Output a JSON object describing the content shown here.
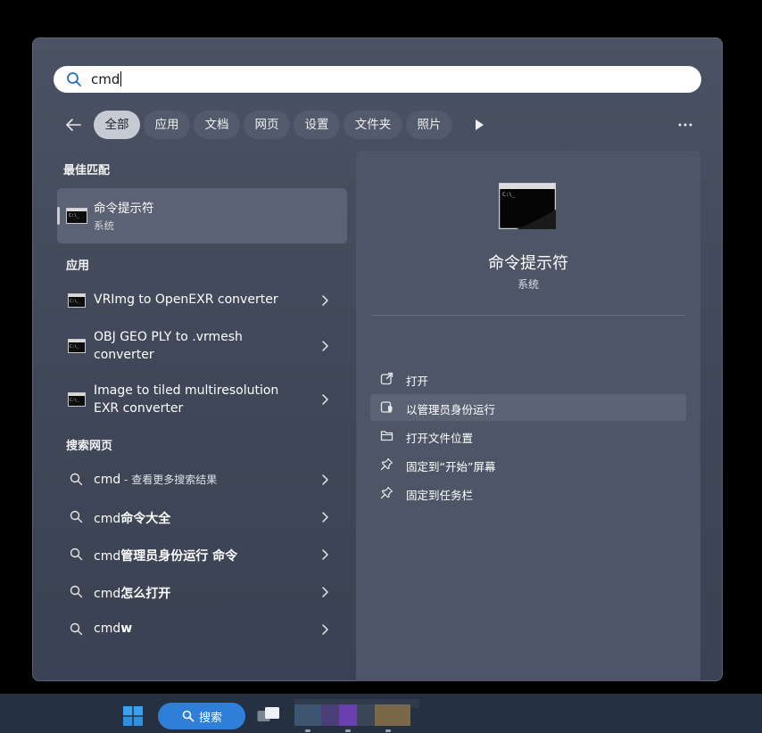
{
  "search": {
    "query": "cmd"
  },
  "filters": [
    {
      "label": "全部",
      "active": true
    },
    {
      "label": "应用"
    },
    {
      "label": "文档"
    },
    {
      "label": "网页"
    },
    {
      "label": "设置"
    },
    {
      "label": "文件夹"
    },
    {
      "label": "照片"
    }
  ],
  "best_match": {
    "heading": "最佳匹配",
    "title": "命令提示符",
    "subtitle": "系统"
  },
  "apps": {
    "heading": "应用",
    "items": [
      {
        "line1": "VRImg to OpenEXR converter",
        "line2": ""
      },
      {
        "line1": "OBJ GEO PLY to .vrmesh",
        "line2": "converter"
      },
      {
        "line1": "Image to tiled multiresolution",
        "line2": "EXR converter"
      }
    ]
  },
  "web": {
    "heading": "搜索网页",
    "items": [
      {
        "prefix": "cmd",
        "bold": "",
        "hint": " - 查看更多搜索结果"
      },
      {
        "prefix": "cmd",
        "bold": "命令大全",
        "hint": ""
      },
      {
        "prefix": "cmd",
        "bold": "管理员身份运行 命令",
        "hint": ""
      },
      {
        "prefix": "cmd",
        "bold": "怎么打开",
        "hint": ""
      },
      {
        "prefix": "cmd",
        "bold": "w",
        "hint": ""
      }
    ]
  },
  "preview": {
    "title": "命令提示符",
    "subtitle": "系统",
    "actions": [
      {
        "label": "打开",
        "icon": "open-external-icon"
      },
      {
        "label": "以管理员身份运行",
        "icon": "admin-shield-icon",
        "highlighted": true
      },
      {
        "label": "打开文件位置",
        "icon": "folder-icon"
      },
      {
        "label": "固定到“开始”屏幕",
        "icon": "pin-icon"
      },
      {
        "label": "固定到任务栏",
        "icon": "pin-icon"
      }
    ]
  },
  "taskbar": {
    "search_label": "搜索"
  },
  "colors": {
    "panel": "#444c5d",
    "accent_blue": "#2f7fd8",
    "active_pill": "#c5cad3"
  }
}
